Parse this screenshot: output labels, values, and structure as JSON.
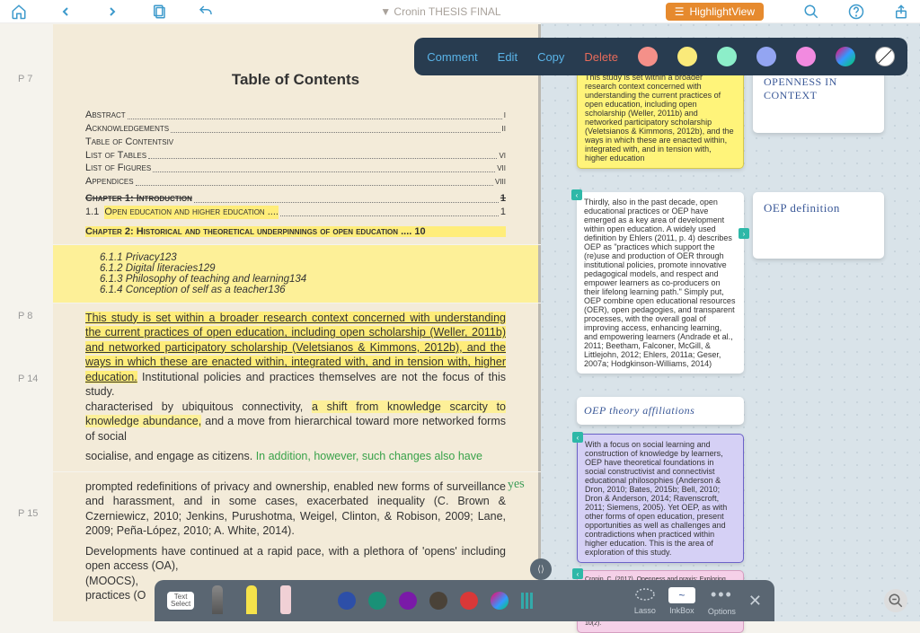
{
  "header": {
    "doc_title_prefix": "▼ ",
    "doc_title": "Cronin THESIS FINAL",
    "highlight_view": "HighlightView"
  },
  "anno_toolbar": {
    "comment": "Comment",
    "edit": "Edit",
    "copy": "Copy",
    "delete": "Delete"
  },
  "pages": {
    "p7_label": "P 7",
    "p8_label": "P 8",
    "p14_label": "P 14",
    "p15_label": "P 15"
  },
  "toc": {
    "title": "Table of Contents",
    "rows": [
      {
        "label": "Abstract",
        "pn": "i"
      },
      {
        "label": "Acknowledgements",
        "pn": "ii"
      },
      {
        "label": "Table of Contents",
        "pn": "iv"
      },
      {
        "label": "List of Tables",
        "pn": "vi"
      },
      {
        "label": "List of Figures",
        "pn": "vii"
      },
      {
        "label": "Appendices",
        "pn": "viii"
      }
    ],
    "ch1_prefix": "Chapter 1: Introduction",
    "ch1_pn": "1",
    "s11_num": "1.1",
    "s11": "Open education and higher education ....",
    "s11_pn": "1",
    "ch2": "Chapter 2: Historical and theoretical underpinnings of open education .... 10",
    "subs": [
      {
        "label": "6.1.1 Privacy",
        "pn": "123"
      },
      {
        "label": "6.1.2 Digital literacies",
        "pn": "129"
      },
      {
        "label": "6.1.3 Philosophy of teaching and learning",
        "pn": "134"
      },
      {
        "label": "6.1.4 Conception of self as a teacher",
        "pn": "136"
      }
    ]
  },
  "prose": {
    "p14a": "This study is set within a broader research context concerned with understanding the current practices of open education, including open scholarship (Weller, 2011b) and networked participatory scholarship (Veletsianos & Kimmons, 2012b), and the ways in which these are enacted within, integrated with, and in tension with, higher education.",
    "p14b": " Institutional policies and practices themselves are not the focus of this study.",
    "p14c": "characterised by ubiquitous connectivity, ",
    "p14d": "a shift from knowledge scarcity to knowledge abundance,",
    "p14e": " and a move from hierarchical toward more networked forms of social",
    "p14f": "socialise, and engage as citizens. ",
    "p14g": "In addition, however, such changes also have",
    "p15a": "prompted redefinitions of privacy and ownership, enabled new forms of surveillance and harassment, and in some cases, exacerbated inequality (C. Brown & Czerniewicz, 2010; Jenkins, Purushotma, Weigel, Clinton, & Robison, 2009; Lane, 2009; Peña-López, 2010; A. White, 2014).",
    "p15b": "Developments have continued at a rapid pace, with a plethora of 'opens' including open access (OA),",
    "p15c": "(MOOCS),",
    "p15d": "practices (O",
    "yes": "yes"
  },
  "notes": {
    "n1": "This study is set within a broader research context concerned with understanding the   current practices of open education, including open scholarship (Weller, 2011b) and   networked participatory scholarship (Veletsianos & Kimmons, 2012b), and the ways   in which these are enacted within, integrated with, and in tension with, higher   education ",
    "n2": "Thirdly, also in the past decade, open educational practices or OEP have emerged as   a key area of development within open education. A widely used definition by Ehlers   (2011, p. 4) describes OEP as \"practices which support the (re)use and production of   OER through institutional policies, promote innovative pedagogical models, and   respect and empower learners as co-producers on their lifelong learning path.\" Simply   put, OEP combine open educational resources (OER), open pedagogies, and transparent processes, with the overall goal of improving access, enhancing learning,  and empowering learners (Andrade et al., 2011; Beetham, Falconer, McGill, &  Littlejohn, 2012; Ehlers, 2011a; Geser, 2007a; Hodgkinson-Williams, 2014) ",
    "n3": "With a focus on social learning and   construction of knowledge by learners, OEP have theoretical foundations in social   constructivist and connectivist educational philosophies (Anderson & Dron, 2010; Bates, 2015b; Bell, 2010; Dron & Anderson, 2014; Ravenscroft, 2011; Siemens, 2005).   Yet OEP, as with other forms of open education, present opportunities as well as   challenges and contradictions when practiced within higher education. This is the area   of exploration of this study.  ",
    "n4a": "Cronin, C. (2017). Openness and praxis: Exploring the use of open educational practices in higher education. The International Review of Research in Open and Distributed Learning (IRRODL), 18(5).",
    "n4b": "Cronin, C. & MacLaren, I. (2018). Conceptualising OEP: A review of the theoretical and empirical literature in Open Educational Practices. Open Praxis, 10(2).",
    "h1": "Openness in context",
    "h2": "OEP definition",
    "h3": "OEP theory affiliations"
  },
  "bottom": {
    "text_select": "Text\nSelect",
    "lasso": "Lasso",
    "inkbox": "InkBox",
    "options": "Options"
  }
}
